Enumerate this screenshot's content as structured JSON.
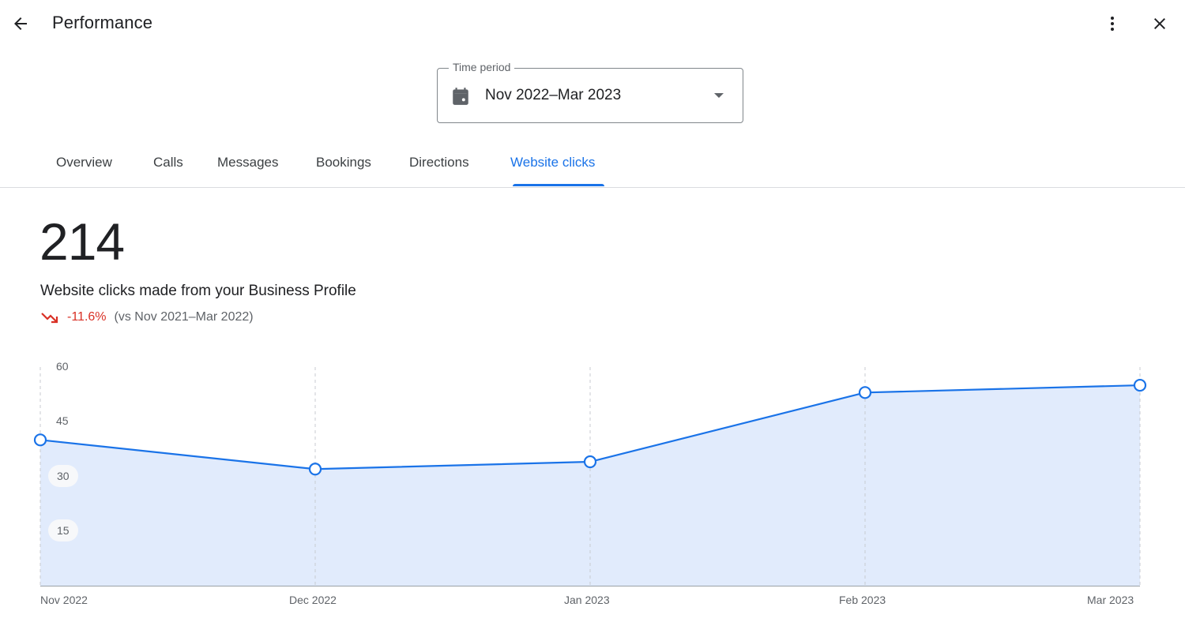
{
  "header": {
    "title": "Performance",
    "back_icon": "arrow-back-icon",
    "more_icon": "more-vert-icon",
    "close_icon": "close-icon"
  },
  "time_period": {
    "label": "Time period",
    "value": "Nov 2022–Mar 2023",
    "icon": "calendar-icon"
  },
  "tabs": [
    {
      "label": "Overview",
      "active": false
    },
    {
      "label": "Calls",
      "active": false
    },
    {
      "label": "Messages",
      "active": false
    },
    {
      "label": "Bookings",
      "active": false
    },
    {
      "label": "Directions",
      "active": false
    },
    {
      "label": "Website clicks",
      "active": true
    }
  ],
  "summary": {
    "total": "214",
    "description": "Website clicks made from your Business Profile",
    "change": "-11.6%",
    "comparison": "(vs Nov 2021–Mar 2022)",
    "trend_icon": "trending-down-icon"
  },
  "colors": {
    "accent": "#1a73e8",
    "negative": "#d93025",
    "fill": "#e1ebfc"
  },
  "chart_data": {
    "type": "area",
    "title": "",
    "xlabel": "",
    "ylabel": "",
    "categories": [
      "Nov 2022",
      "Dec 2022",
      "Jan 2023",
      "Feb 2023",
      "Mar 2023"
    ],
    "series": [
      {
        "name": "Website clicks",
        "values": [
          40,
          32,
          34,
          53,
          55
        ]
      }
    ],
    "y_ticks": [
      "60",
      "45",
      "30",
      "15"
    ],
    "ylim": [
      0,
      60
    ],
    "grid": "vertical dashed",
    "legend": "none"
  }
}
